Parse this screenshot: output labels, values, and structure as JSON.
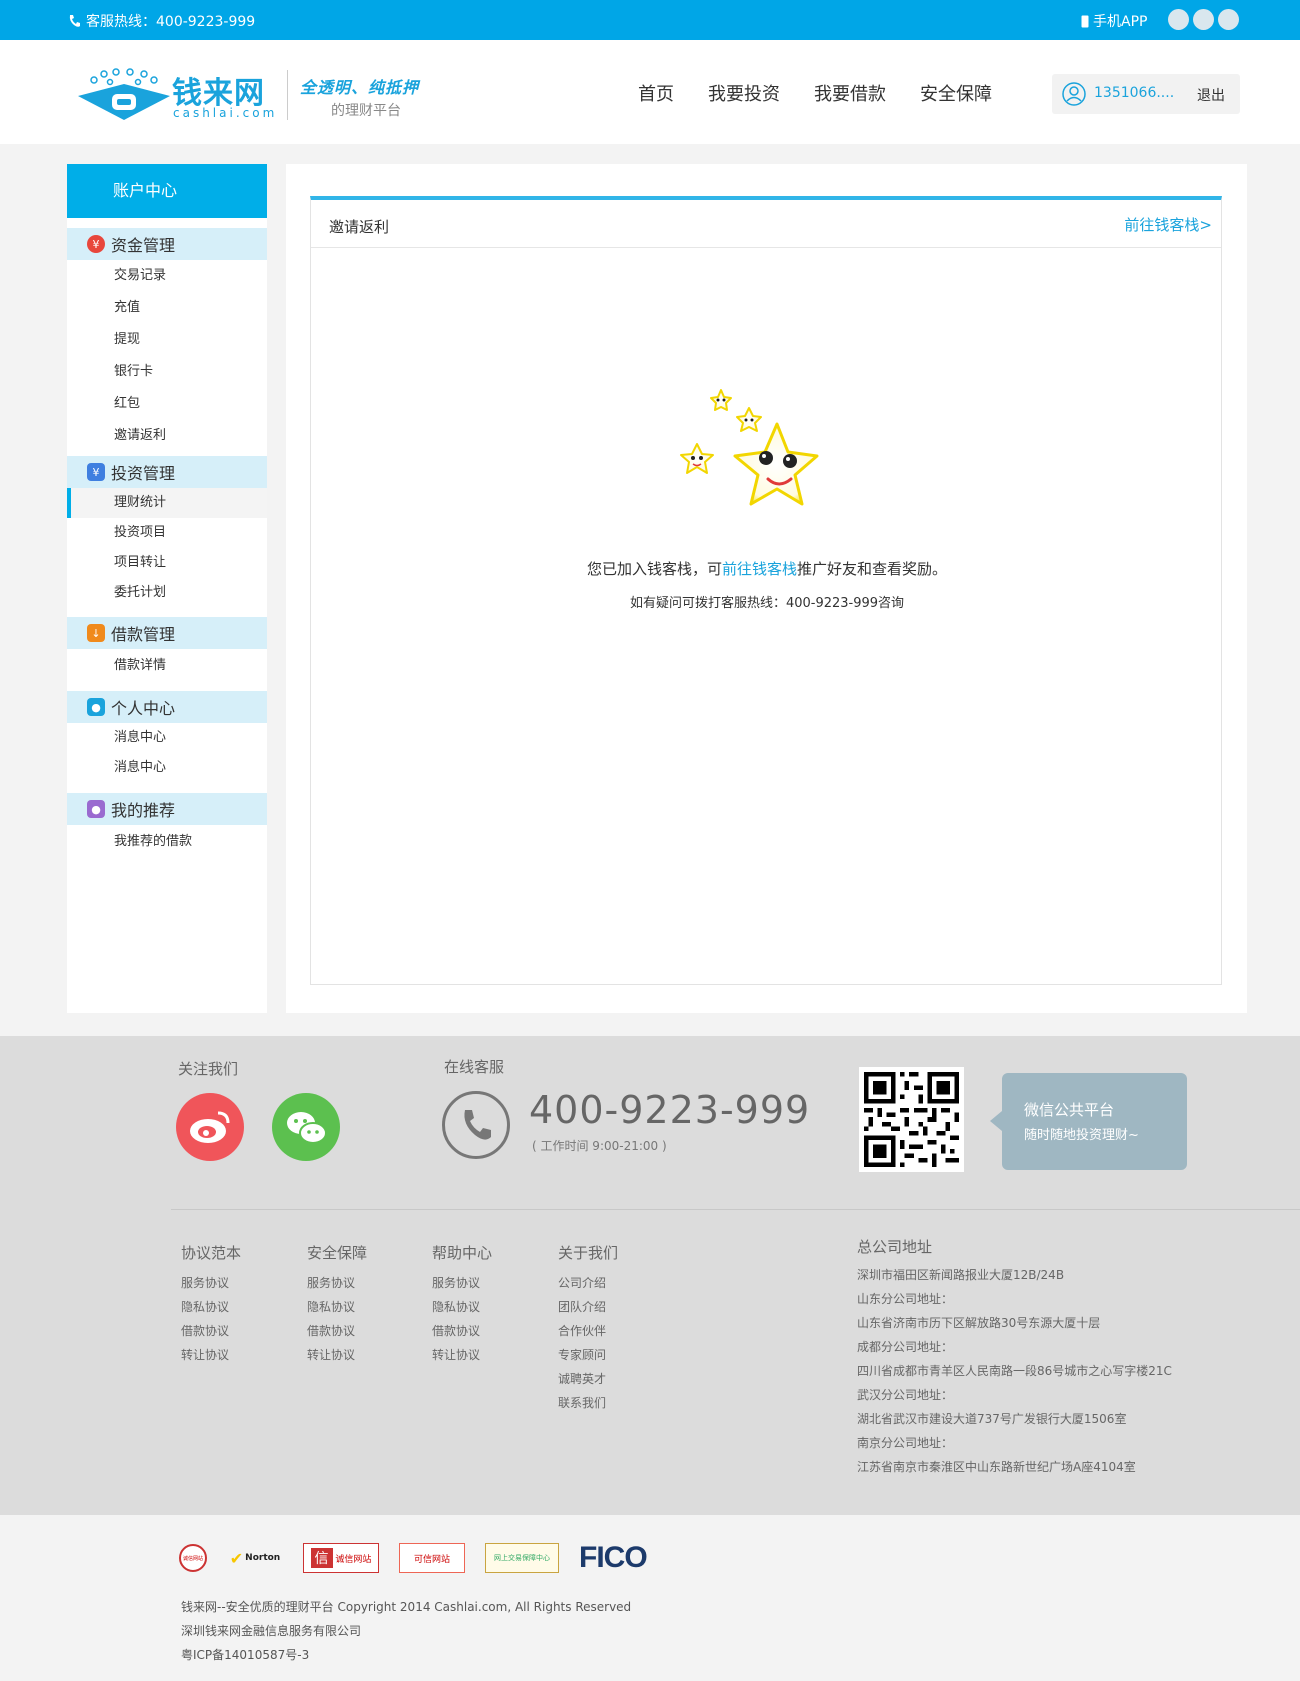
{
  "topbar": {
    "hotline": "客服热线：400-9223-999",
    "app": "手机APP",
    "social_icons": [
      "wechat-icon",
      "weibo-icon",
      "other-icon"
    ]
  },
  "header": {
    "logo_text": "钱来网",
    "logo_sub": "cashlai.com",
    "slogan1": "全透明、纯抵押",
    "slogan2": "的理财平台",
    "nav": [
      "首页",
      "我要投资",
      "我要借款",
      "安全保障"
    ],
    "user": "1351066....",
    "logout": "退出"
  },
  "sidebar": {
    "title": "账户中心",
    "groups": [
      {
        "title": "资金管理",
        "icon": "money-bag-icon",
        "color": "#e8473c",
        "items": [
          "交易记录",
          "充值",
          "提现",
          "银行卡",
          "红包",
          "邀请返利"
        ]
      },
      {
        "title": "投资管理",
        "icon": "yen-icon",
        "color": "#3f7fe0",
        "items": [
          "理财统计",
          "投资项目",
          "项目转让",
          "委托计划"
        ]
      },
      {
        "title": "借款管理",
        "icon": "borrow-icon",
        "color": "#f08a1c",
        "items": [
          "借款详情"
        ]
      },
      {
        "title": "个人中心",
        "icon": "user-icon",
        "color": "#1aa3dc",
        "items": [
          "消息中心",
          "消息中心"
        ]
      },
      {
        "title": "我的推荐",
        "icon": "group-icon",
        "color": "#9a6ad0",
        "items": [
          "我推荐的借款"
        ]
      }
    ],
    "active_item": "理财统计"
  },
  "main": {
    "panel_title": "邀请返利",
    "panel_link": "前往钱客栈>",
    "msg_pre": "您已加入钱客栈，可",
    "msg_link": "前往钱客栈",
    "msg_post": "推广好友和查看奖励。",
    "msg2": "如有疑问可拨打客服热线：400-9223-999咨询"
  },
  "footer": {
    "follow_title": "关注我们",
    "service_title": "在线客服",
    "phone": "400-9223-999",
    "worktime": "( 工作时间 9:00-21:00 )",
    "wechat_title": "微信公共平台",
    "wechat_sub": "随时随地投资理财~",
    "cols": [
      {
        "title": "协议范本",
        "items": [
          "服务协议",
          "隐私协议",
          "借款协议",
          "转让协议"
        ]
      },
      {
        "title": "安全保障",
        "items": [
          "服务协议",
          "隐私协议",
          "借款协议",
          "转让协议"
        ]
      },
      {
        "title": "帮助中心",
        "items": [
          "服务协议",
          "隐私协议",
          "借款协议",
          "转让协议"
        ]
      },
      {
        "title": "关于我们",
        "items": [
          "公司介绍",
          "团队介绍",
          "合作伙伴",
          "专家顾问",
          "诚聘英才",
          "联系我们"
        ]
      }
    ],
    "addr_title": "总公司地址",
    "addr_lines": [
      "深圳市福田区新闻路报业大厦12B/24B",
      "山东分公司地址：",
      "山东省济南市历下区解放路30号东源大厦十层",
      "成都分公司地址：",
      "四川省成都市青羊区人民南路一段86号城市之心写字楼21C",
      "武汉分公司地址：",
      "湖北省武汉市建设大道737号广发银行大厦1506室",
      "南京分公司地址：",
      "江苏省南京市秦淮区中山东路新世纪广场A座4104室"
    ]
  },
  "bottom": {
    "badges": [
      "诚信网站",
      "Norton",
      "诚信网站",
      "可信网站",
      "网上交易保障中心"
    ],
    "fico": "FICO",
    "copyright": "钱来网--安全优质的理财平台 Copyright 2014 Cashlai.com, All Rights Reserved",
    "company": "深圳钱来网金融信息服务有限公司",
    "icp": "粤ICP备14010587号-3"
  }
}
